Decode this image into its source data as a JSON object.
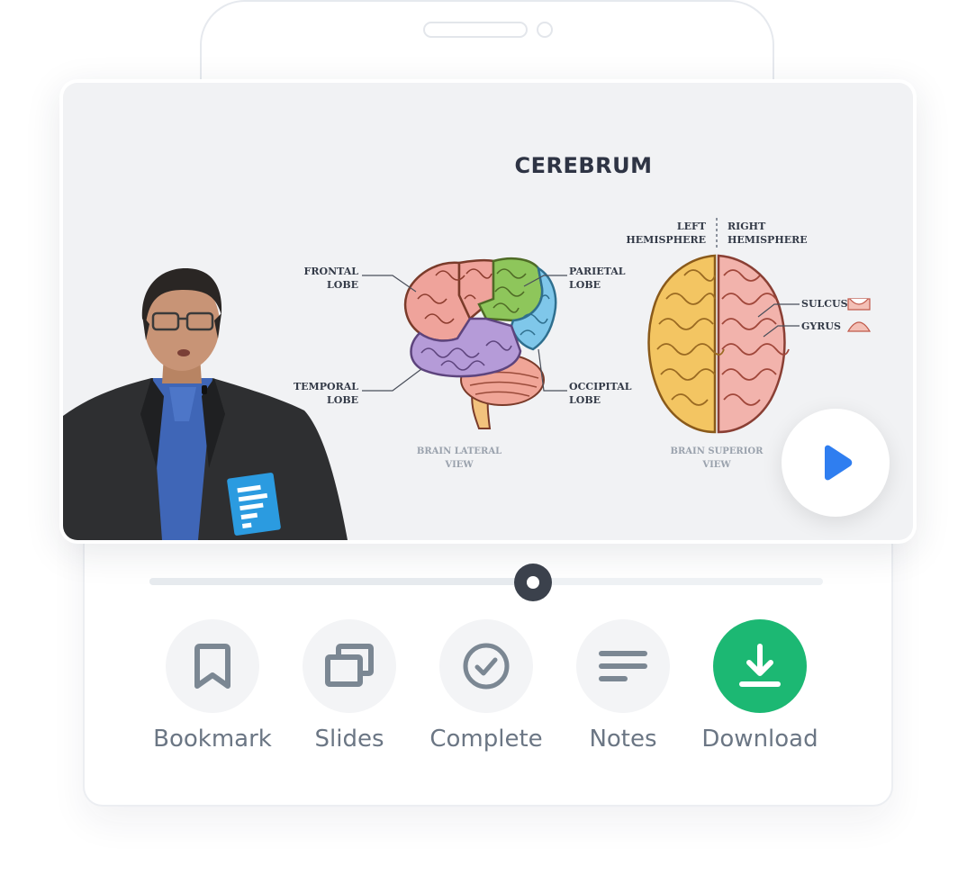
{
  "slide": {
    "title": "CEREBRUM",
    "lateral": {
      "labels": {
        "frontal": [
          "FRONTAL",
          "LOBE"
        ],
        "parietal": [
          "PARIETAL",
          "LOBE"
        ],
        "temporal": [
          "TEMPORAL",
          "LOBE"
        ],
        "occipital": [
          "OCCIPITAL",
          "LOBE"
        ]
      },
      "caption": [
        "BRAIN LATERAL",
        "VIEW"
      ]
    },
    "superior": {
      "left_hemisphere": [
        "LEFT",
        "HEMISPHERE"
      ],
      "right_hemisphere": [
        "RIGHT",
        "HEMISPHERE"
      ],
      "sulcus": "SULCUS",
      "gyrus": "GYRUS",
      "caption": [
        "BRAIN SUPERIOR",
        "VIEW"
      ]
    }
  },
  "player": {
    "progress_fraction": 0.57
  },
  "actions": [
    {
      "label": "Bookmark",
      "icon": "bookmark-icon"
    },
    {
      "label": "Slides",
      "icon": "slides-icon"
    },
    {
      "label": "Complete",
      "icon": "check-circle-icon"
    },
    {
      "label": "Notes",
      "icon": "notes-icon"
    },
    {
      "label": "Download",
      "icon": "download-icon",
      "accent": "#1cb873"
    }
  ],
  "colors": {
    "play_icon": "#2f7ef0",
    "download_button": "#1cb873",
    "icon_gray": "#7b8793"
  }
}
